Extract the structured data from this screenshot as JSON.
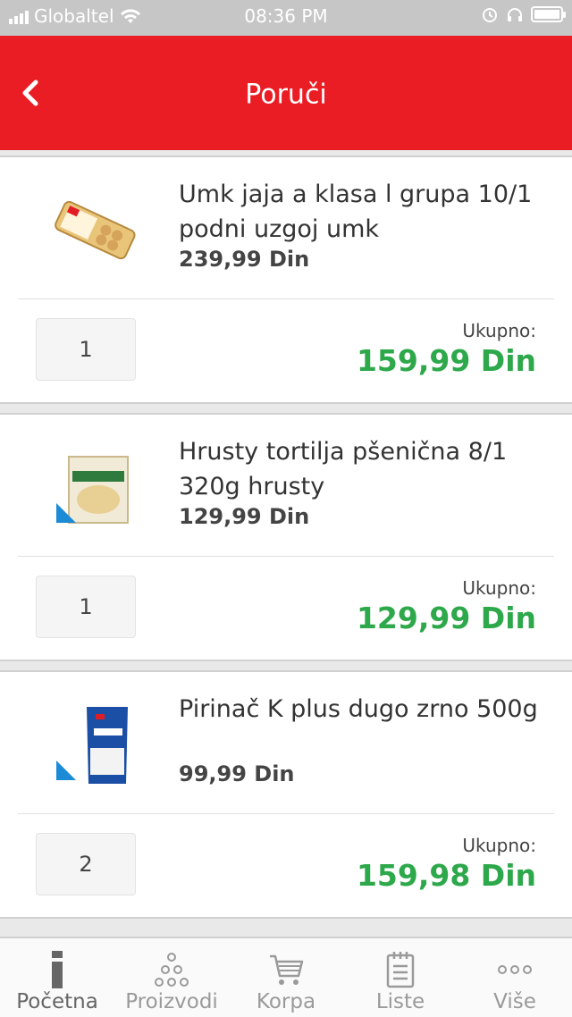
{
  "status_bar": {
    "carrier": "Globaltel",
    "time": "08:36 PM"
  },
  "header": {
    "title": "Poruči",
    "back_icon": "chevron-left-icon"
  },
  "colors": {
    "brand": "#ea1c24",
    "total": "#2da84a"
  },
  "items": [
    {
      "name": "Umk jaja a klasa l grupa 10/1 podni uzgoj umk",
      "price": "239,99 Din",
      "quantity": "1",
      "total_label": "Ukupno:",
      "total": "159,99 Din",
      "image_icon": "egg-carton-icon"
    },
    {
      "name": "Hrusty tortilja pšenična 8/1 320g hrusty",
      "price": "129,99 Din",
      "quantity": "1",
      "total_label": "Ukupno:",
      "total": "129,99 Din",
      "image_icon": "tortilla-pack-icon"
    },
    {
      "name": "Pirinač K plus dugo zrno 500g",
      "price": "99,99 Din",
      "quantity": "2",
      "total_label": "Ukupno:",
      "total": "159,98 Din",
      "image_icon": "rice-bag-icon"
    }
  ],
  "tabs": [
    {
      "label": "Početna",
      "icon": "home-icon"
    },
    {
      "label": "Proizvodi",
      "icon": "products-icon"
    },
    {
      "label": "Korpa",
      "icon": "cart-icon"
    },
    {
      "label": "Liste",
      "icon": "list-icon"
    },
    {
      "label": "Više",
      "icon": "more-icon"
    }
  ]
}
